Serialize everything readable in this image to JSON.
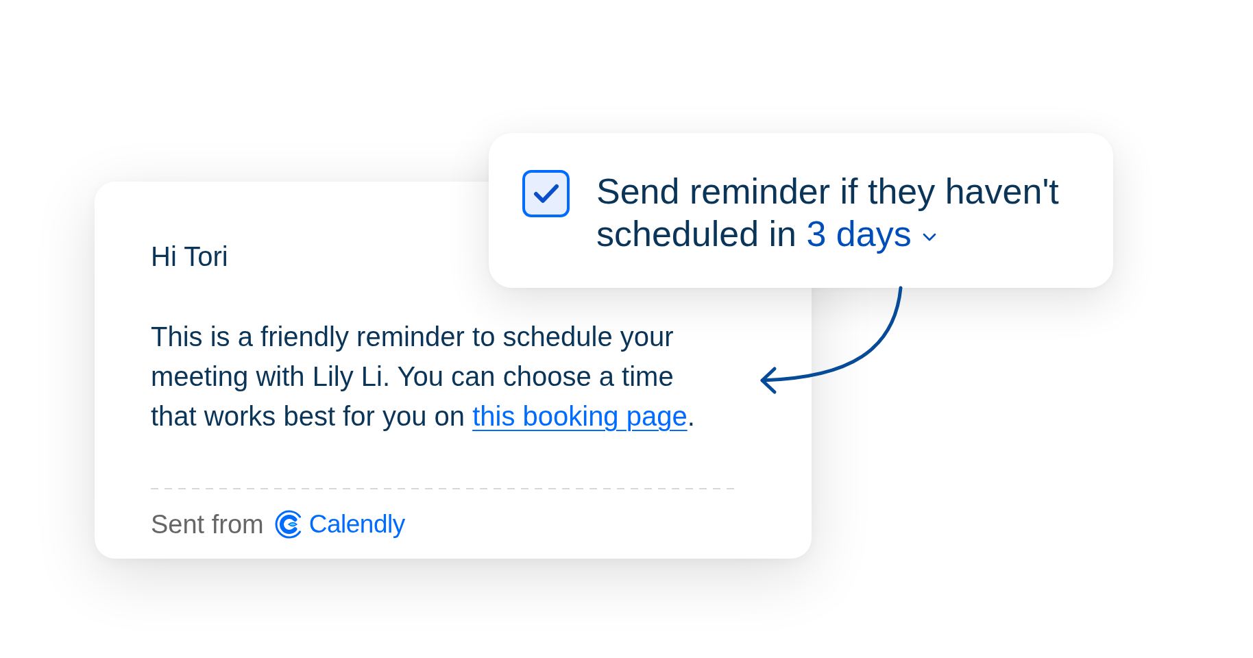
{
  "email": {
    "greeting": "Hi Tori",
    "body": "This is a friendly reminder to schedule your meeting with Lily Li. You can choose a time that works best for you on",
    "link": "this booking page",
    "body_end": ".",
    "footer": {
      "label": "Sent from",
      "brand": "Calendly"
    }
  },
  "reminder": {
    "checked": true,
    "label": "Send reminder if they haven't scheduled in",
    "delay": "3 days"
  }
}
